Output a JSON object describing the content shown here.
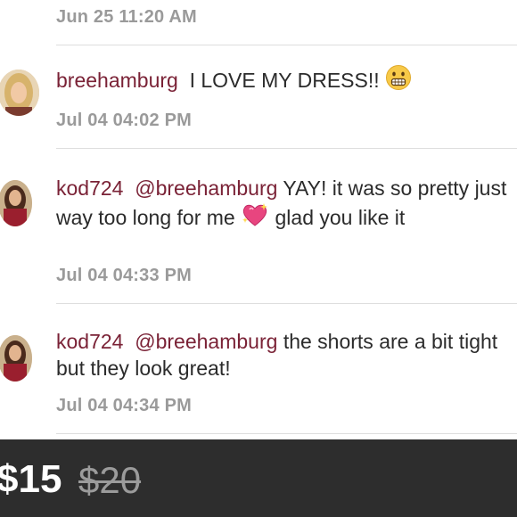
{
  "comments": [
    {
      "timestamp": "Jun 25 11:20 AM"
    },
    {
      "username": "breehamburg",
      "text": "I LOVE MY DRESS!!",
      "emoji": "grimacing-face-emoji",
      "timestamp": "Jul 04 04:02 PM"
    },
    {
      "username": "kod724",
      "mention": "@breehamburg",
      "text_before_emoji": "YAY! it was so pretty just way too long for me",
      "emoji": "sparkling-heart-emoji",
      "text_after_emoji": "glad you like it",
      "timestamp": "Jul 04 04:33 PM"
    },
    {
      "username": "kod724",
      "mention": "@breehamburg",
      "text": "the shorts are a bit tight but they look great!",
      "timestamp": "Jul 04 04:34 PM"
    }
  ],
  "price": {
    "current": "$15",
    "original": "$20"
  },
  "colors": {
    "username": "#7a2236",
    "timestamp": "#9a9a9a",
    "price_bar": "#2d2d2d"
  }
}
